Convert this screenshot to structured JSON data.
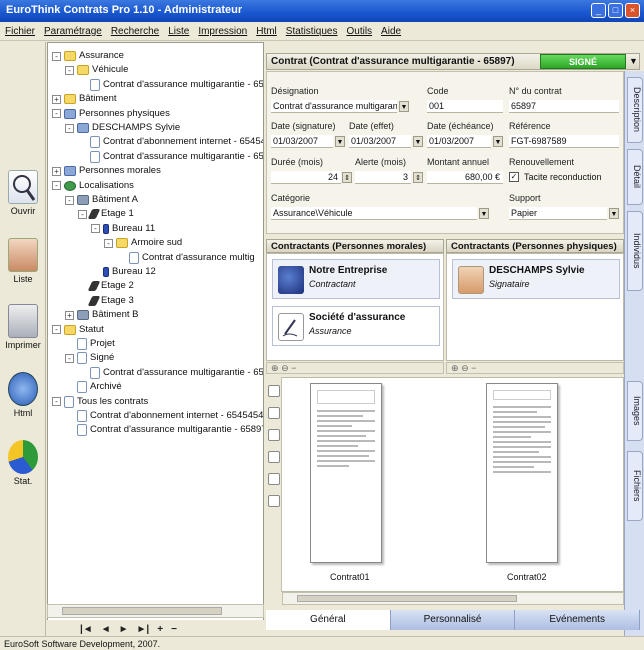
{
  "window": {
    "title": "EuroThink Contrats Pro 1.10 - Administrateur"
  },
  "menu": [
    "Fichier",
    "Paramétrage",
    "Recherche",
    "Liste",
    "Impression",
    "Html",
    "Statistiques",
    "Outils",
    "Aide"
  ],
  "left_toolbar": [
    "Ouvrir",
    "Liste",
    "Imprimer",
    "Html",
    "Stat."
  ],
  "tree": [
    {
      "label": "Assurance",
      "indent": 0,
      "icon": "folder",
      "pm": "-"
    },
    {
      "label": "Véhicule",
      "indent": 1,
      "icon": "folder",
      "pm": "-"
    },
    {
      "label": "Contrat d'assurance multigarantie - 658",
      "indent": 2,
      "icon": "doc",
      "pm": ""
    },
    {
      "label": "Bâtiment",
      "indent": 0,
      "icon": "folder",
      "pm": "+"
    },
    {
      "label": "Personnes physiques",
      "indent": 0,
      "icon": "people",
      "pm": "-"
    },
    {
      "label": "DESCHAMPS Sylvie",
      "indent": 1,
      "icon": "people",
      "pm": "-"
    },
    {
      "label": "Contrat d'abonnement internet - 65454",
      "indent": 2,
      "icon": "doc",
      "pm": ""
    },
    {
      "label": "Contrat d'assurance multigarantie - 658",
      "indent": 2,
      "icon": "doc",
      "pm": ""
    },
    {
      "label": "Personnes morales",
      "indent": 0,
      "icon": "people",
      "pm": "+"
    },
    {
      "label": "Localisations",
      "indent": 0,
      "icon": "globe",
      "pm": "-"
    },
    {
      "label": "Bâtiment A",
      "indent": 1,
      "icon": "bldg",
      "pm": "-"
    },
    {
      "label": "Etage 1",
      "indent": 2,
      "icon": "pen",
      "pm": "-"
    },
    {
      "label": "Bureau 11",
      "indent": 3,
      "icon": "blue",
      "pm": "-"
    },
    {
      "label": "Armoire sud",
      "indent": 4,
      "icon": "folder",
      "pm": "-"
    },
    {
      "label": "Contrat d'assurance multig",
      "indent": 5,
      "icon": "doc",
      "pm": ""
    },
    {
      "label": "Bureau 12",
      "indent": 3,
      "icon": "blue",
      "pm": ""
    },
    {
      "label": "Etage 2",
      "indent": 2,
      "icon": "pen",
      "pm": ""
    },
    {
      "label": "Etage 3",
      "indent": 2,
      "icon": "pen",
      "pm": ""
    },
    {
      "label": "Bâtiment B",
      "indent": 1,
      "icon": "bldg",
      "pm": "+"
    },
    {
      "label": "Statut",
      "indent": 0,
      "icon": "folder",
      "pm": "-"
    },
    {
      "label": "Projet",
      "indent": 1,
      "icon": "doc",
      "pm": ""
    },
    {
      "label": "Signé",
      "indent": 1,
      "icon": "doc",
      "pm": "-"
    },
    {
      "label": "Contrat d'assurance multigarantie - 658",
      "indent": 2,
      "icon": "doc",
      "pm": ""
    },
    {
      "label": "Archivé",
      "indent": 1,
      "icon": "doc",
      "pm": ""
    },
    {
      "label": "Tous les contrats",
      "indent": 0,
      "icon": "doc",
      "pm": "-"
    },
    {
      "label": "Contrat d'abonnement internet - 6545454 (",
      "indent": 1,
      "icon": "doc",
      "pm": ""
    },
    {
      "label": "Contrat d'assurance multigarantie - 65897 (",
      "indent": 1,
      "icon": "doc",
      "pm": ""
    }
  ],
  "tree_nav": [
    "|◄",
    "◄",
    "►",
    "►|",
    "+",
    "−"
  ],
  "contract": {
    "header": "Contrat (Contrat d'assurance multigarantie - 65897)",
    "status": "SIGNÉ",
    "labels": {
      "designation": "Désignation",
      "code": "Code",
      "numero": "N° du contrat",
      "date_signature": "Date (signature)",
      "date_effet": "Date (effet)",
      "date_echeance": "Date (échéance)",
      "reference": "Référence",
      "duree": "Durée (mois)",
      "alerte": "Alerte (mois)",
      "montant": "Montant annuel",
      "renouvellement": "Renouvellement",
      "categorie": "Catégorie",
      "support": "Support"
    },
    "values": {
      "designation": "Contrat d'assurance multigarantie",
      "code": "001",
      "numero": "65897",
      "date_signature": "01/03/2007",
      "date_effet": "01/03/2007",
      "date_echeance": "01/03/2007",
      "reference": "FGT-6987589",
      "duree": "24",
      "alerte": "3",
      "montant": "680,00 €",
      "renouvellement": "Tacite reconduction",
      "categorie": "Assurance\\Véhicule",
      "support": "Papier"
    }
  },
  "contractants_morales": {
    "header": "Contractants (Personnes morales)",
    "items": [
      {
        "name": "Notre Entreprise",
        "role": "Contractant"
      },
      {
        "name": "Société d'assurance",
        "role": "Assurance"
      }
    ]
  },
  "contractants_physiques": {
    "header": "Contractants (Personnes physiques)",
    "items": [
      {
        "name": "DESCHAMPS Sylvie",
        "role": "Signataire"
      }
    ]
  },
  "documents": [
    "Contrat01",
    "Contrat02"
  ],
  "right_tabs": [
    "Description",
    "Détail",
    "Individus",
    "Images",
    "Fichiers"
  ],
  "bottom_tabs": [
    {
      "label": "Général",
      "active": true
    },
    {
      "label": "Personnalisé",
      "active": false
    },
    {
      "label": "Evénements",
      "active": false
    }
  ],
  "statusbar": "EuroSoft Software Development, 2007."
}
